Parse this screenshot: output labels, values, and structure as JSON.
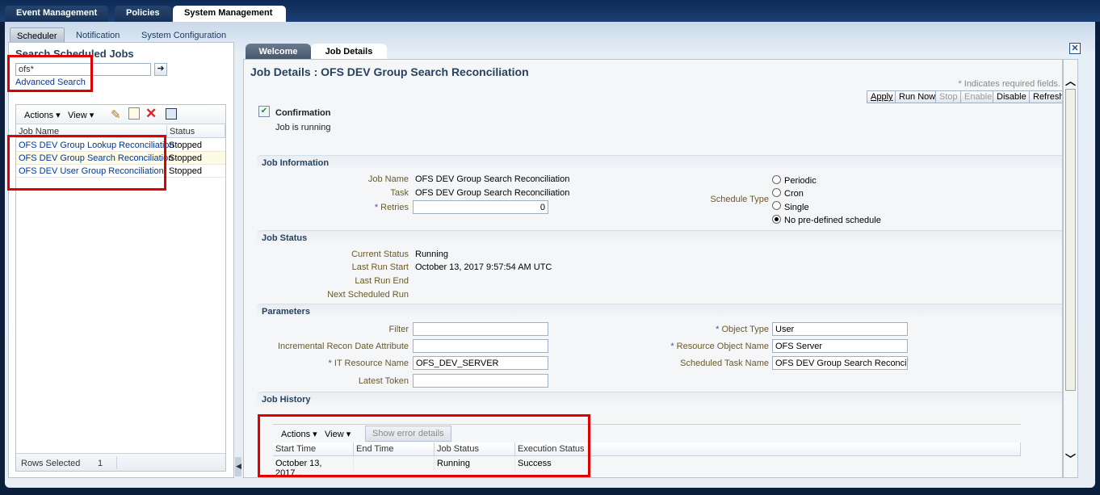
{
  "top_tabs": [
    "Event Management",
    "Policies",
    "System Management"
  ],
  "sub_tabs": [
    "Scheduler",
    "Notification",
    "System Configuration"
  ],
  "left": {
    "title": "Search Scheduled Jobs",
    "search_value": "ofs*",
    "advanced_search": "Advanced Search",
    "toolbar": {
      "actions": "Actions",
      "view": "View"
    },
    "columns": [
      "Job Name",
      "Status"
    ],
    "jobs": [
      {
        "name": "OFS DEV Group Lookup Reconciliation",
        "status": "Stopped"
      },
      {
        "name": "OFS DEV Group Search Reconciliation",
        "status": "Stopped"
      },
      {
        "name": "OFS DEV User Group Reconciliation",
        "status": "Stopped"
      }
    ],
    "rows_selected_label": "Rows Selected",
    "rows_selected_value": "1"
  },
  "right": {
    "tabs": [
      "Welcome",
      "Job Details"
    ],
    "page_title": "Job Details : OFS DEV Group Search Reconciliation",
    "required_note": "* Indicates required fields.",
    "buttons": [
      "Apply",
      "Run Now",
      "Stop",
      "Enable",
      "Disable",
      "Refresh"
    ],
    "confirmation": {
      "title": "Confirmation",
      "message": "Job is running"
    },
    "job_information": {
      "heading": "Job Information",
      "job_name_label": "Job Name",
      "job_name": "OFS DEV Group Search Reconciliation",
      "task_label": "Task",
      "task": "OFS DEV Group Search Reconciliation",
      "retries_label": "Retries",
      "retries": "0",
      "schedule_type_label": "Schedule Type",
      "schedule_options": [
        "Periodic",
        "Cron",
        "Single",
        "No pre-defined schedule"
      ],
      "selected_schedule": "No pre-defined schedule"
    },
    "job_status": {
      "heading": "Job Status",
      "current_status_label": "Current Status",
      "current_status": "Running",
      "last_run_start_label": "Last Run Start",
      "last_run_start": "October 13, 2017 9:57:54 AM UTC",
      "last_run_end_label": "Last Run End",
      "last_run_end": "",
      "next_scheduled_run_label": "Next Scheduled Run",
      "next_scheduled_run": ""
    },
    "parameters": {
      "heading": "Parameters",
      "filter_label": "Filter",
      "filter": "",
      "incremental_label": "Incremental Recon Date Attribute",
      "incremental": "",
      "it_resource_label": "IT Resource Name",
      "it_resource": "OFS_DEV_SERVER",
      "latest_token_label": "Latest Token",
      "latest_token": "",
      "object_type_label": "Object Type",
      "object_type": "User",
      "resource_object_label": "Resource Object Name",
      "resource_object": "OFS Server",
      "scheduled_task_label": "Scheduled Task Name",
      "scheduled_task": "OFS DEV Group Search Reconciliati"
    },
    "job_history": {
      "heading": "Job History",
      "toolbar": {
        "actions": "Actions",
        "view": "View",
        "show_errors": "Show error details"
      },
      "columns": [
        "Start Time",
        "End Time",
        "Job Status",
        "Execution Status"
      ],
      "rows": [
        {
          "start": "October 13, 2017...",
          "end": "",
          "status": "Running",
          "execution": "Success"
        }
      ]
    }
  }
}
